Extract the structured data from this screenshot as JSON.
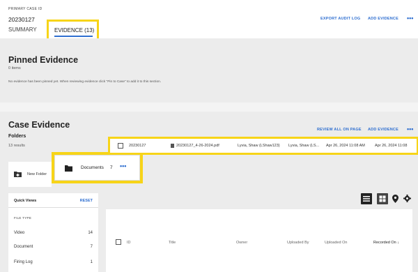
{
  "header": {
    "case_label": "PRIMARY CASE ID",
    "case_id": "20230127",
    "tabs": [
      {
        "label": "SUMMARY"
      },
      {
        "label": "EVIDENCE (13)"
      }
    ],
    "export_audit_log": "EXPORT AUDIT LOG",
    "add_evidence": "ADD EVIDENCE",
    "more": "•••"
  },
  "pinned": {
    "title": "Pinned Evidence",
    "count": "0 items",
    "empty_message": "No evidence has been pinned yet. When reviewing evidence click \"Pin to Case\" to add it to this section."
  },
  "case_evidence": {
    "title": "Case Evidence",
    "folders_label": "Folders",
    "results": "13 results",
    "review_all": "REVIEW ALL ON PAGE",
    "add_evidence": "ADD EVIDENCE",
    "more": "•••",
    "new_folder": "New Folder",
    "folder": {
      "name": "Documents",
      "count": "7",
      "more": "•••"
    }
  },
  "quick_views": {
    "title": "Quick Views",
    "reset": "RESET",
    "section": "FILE TYPE",
    "items": [
      {
        "label": "Video",
        "count": "14"
      },
      {
        "label": "Document",
        "count": "7"
      },
      {
        "label": "Firing Log",
        "count": "1"
      }
    ]
  },
  "table": {
    "columns": [
      "ID",
      "Title",
      "Owner",
      "Uploaded By",
      "Uploaded On",
      "Recorded On ↓"
    ],
    "rows": [
      {
        "id": "20230127",
        "title": "20230127_4-26-2024.pdf",
        "owner": "Lyvia, Shaw (LShaw123)",
        "uploaded_by": "Lyvia, Shaw (LS...",
        "uploaded_on": "Apr 26, 2024 11:08 AM",
        "recorded_on": "Apr 26, 2024 11:08"
      }
    ]
  },
  "colors": {
    "accent": "#2f6fd0",
    "highlight": "#f7d418",
    "panel_bg": "#ececec"
  }
}
